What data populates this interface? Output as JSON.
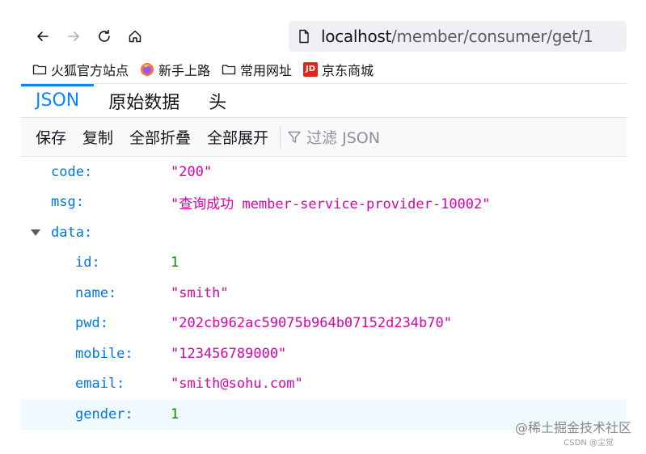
{
  "browser": {
    "url_host": "localhost",
    "url_path": "/member/consumer/get/1"
  },
  "bookmarks": [
    {
      "label": "火狐官方站点",
      "icon": "folder-icon"
    },
    {
      "label": "新手上路",
      "icon": "firefox-icon"
    },
    {
      "label": "常用网址",
      "icon": "folder-icon"
    },
    {
      "label": "京东商城",
      "icon": "jd-icon",
      "icon_text": "JD"
    }
  ],
  "viewer_tabs": [
    {
      "label": "JSON",
      "active": true
    },
    {
      "label": "原始数据",
      "active": false
    },
    {
      "label": "头",
      "active": false
    }
  ],
  "viewer_toolbar": {
    "save": "保存",
    "copy": "复制",
    "collapse_all": "全部折叠",
    "expand_all": "全部展开",
    "filter_placeholder": "过滤 JSON"
  },
  "json": {
    "code": {
      "key": "code:",
      "value": "\"200\""
    },
    "msg": {
      "key": "msg:",
      "value": "\"查询成功 member-service-provider-10002\""
    },
    "data": {
      "key": "data:",
      "id": {
        "key": "id:",
        "value": "1"
      },
      "name": {
        "key": "name:",
        "value": "\"smith\""
      },
      "pwd": {
        "key": "pwd:",
        "value": "\"202cb962ac59075b964b07152d234b70\""
      },
      "mobile": {
        "key": "mobile:",
        "value": "\"123456789000\""
      },
      "email": {
        "key": "email:",
        "value": "\"smith@sohu.com\""
      },
      "gender": {
        "key": "gender:",
        "value": "1"
      }
    }
  },
  "watermark": {
    "main": "@稀土掘金技术社区",
    "sub": "CSDN @尘觉"
  },
  "colors": {
    "accent": "#0a84ff",
    "key": "#0074e8",
    "string": "#dd00a9",
    "number": "#058b00"
  }
}
